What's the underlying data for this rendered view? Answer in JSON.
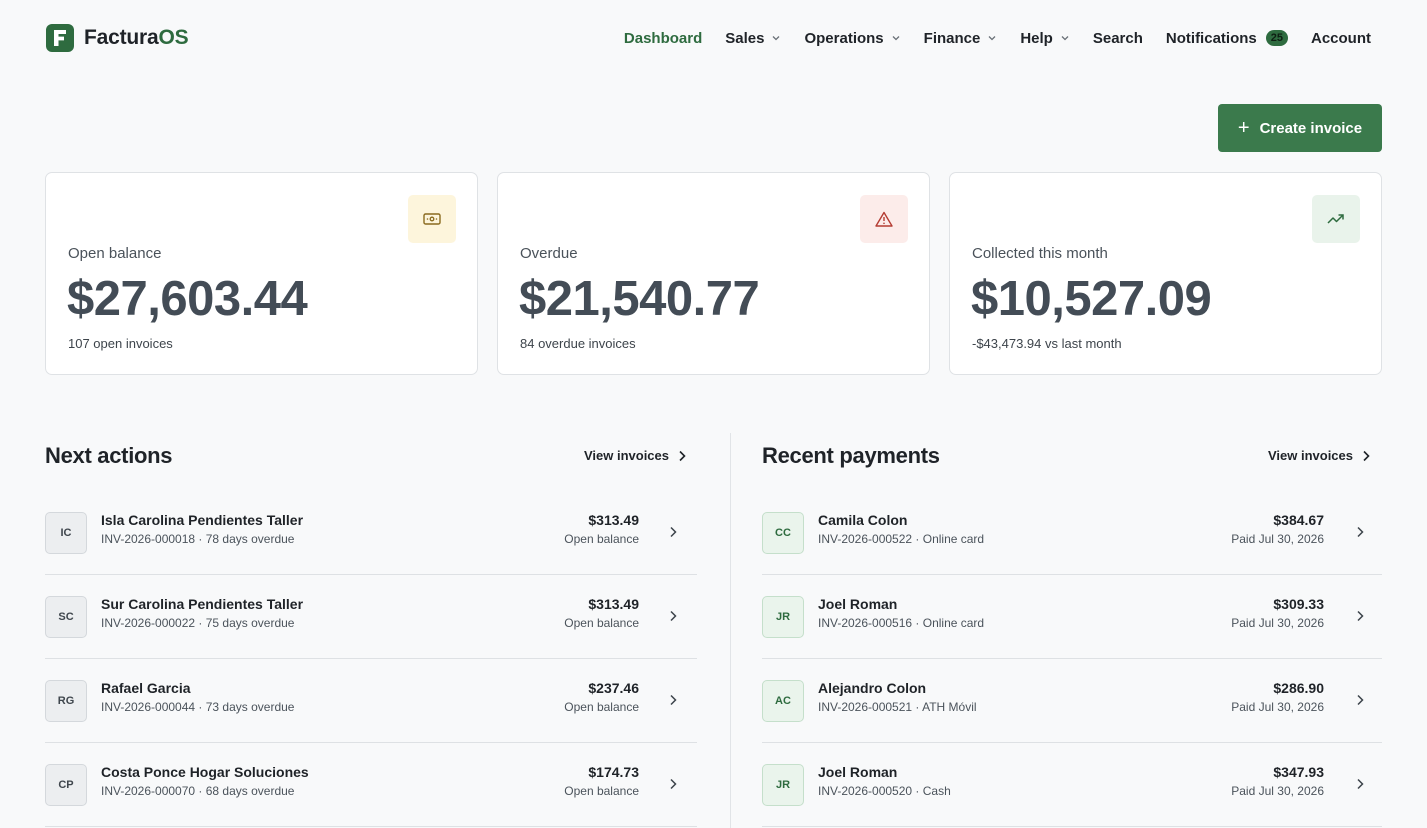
{
  "brand": {
    "name_main": "Factura",
    "name_accent": "OS"
  },
  "nav": {
    "dashboard": "Dashboard",
    "sales": "Sales",
    "operations": "Operations",
    "finance": "Finance",
    "help": "Help",
    "search": "Search",
    "notifications": "Notifications",
    "notifications_count": "25",
    "account": "Account"
  },
  "create_button": "Create invoice",
  "cards": {
    "open_balance": {
      "label": "Open balance",
      "amount": "$27,603.44",
      "sub": "107 open invoices",
      "icon": "banknote-icon",
      "accent": "#fdf5dc"
    },
    "overdue": {
      "label": "Overdue",
      "amount": "$21,540.77",
      "sub": "84 overdue invoices",
      "icon": "alert-triangle-icon",
      "accent": "#fcecea"
    },
    "collected": {
      "label": "Collected this month",
      "amount": "$10,527.09",
      "sub": "-$43,473.94 vs last month",
      "icon": "trending-up-icon",
      "accent": "#e9f3eb"
    }
  },
  "next_actions": {
    "title": "Next actions",
    "link": "View invoices",
    "items": [
      {
        "initials": "IC",
        "name": "Isla Carolina Pendientes Taller",
        "meta": "INV-2026-000018 · 78 days overdue",
        "amount": "$313.49",
        "amount_label": "Open balance"
      },
      {
        "initials": "SC",
        "name": "Sur Carolina Pendientes Taller",
        "meta": "INV-2026-000022 · 75 days overdue",
        "amount": "$313.49",
        "amount_label": "Open balance"
      },
      {
        "initials": "RG",
        "name": "Rafael Garcia",
        "meta": "INV-2026-000044 · 73 days overdue",
        "amount": "$237.46",
        "amount_label": "Open balance"
      },
      {
        "initials": "CP",
        "name": "Costa Ponce Hogar Soluciones",
        "meta": "INV-2026-000070 · 68 days overdue",
        "amount": "$174.73",
        "amount_label": "Open balance"
      }
    ]
  },
  "recent_payments": {
    "title": "Recent payments",
    "link": "View invoices",
    "items": [
      {
        "initials": "CC",
        "name": "Camila Colon",
        "meta": "INV-2026-000522 · Online card",
        "amount": "$384.67",
        "amount_label": "Paid Jul 30, 2026"
      },
      {
        "initials": "JR",
        "name": "Joel Roman",
        "meta": "INV-2026-000516 · Online card",
        "amount": "$309.33",
        "amount_label": "Paid Jul 30, 2026"
      },
      {
        "initials": "AC",
        "name": "Alejandro Colon",
        "meta": "INV-2026-000521 · ATH Móvil",
        "amount": "$286.90",
        "amount_label": "Paid Jul 30, 2026"
      },
      {
        "initials": "JR",
        "name": "Joel Roman",
        "meta": "INV-2026-000520 · Cash",
        "amount": "$347.93",
        "amount_label": "Paid Jul 30, 2026"
      }
    ]
  },
  "colors": {
    "brand": "#2e6b3f",
    "button": "#3b7a4c",
    "page_bg": "#f8f9fa"
  }
}
